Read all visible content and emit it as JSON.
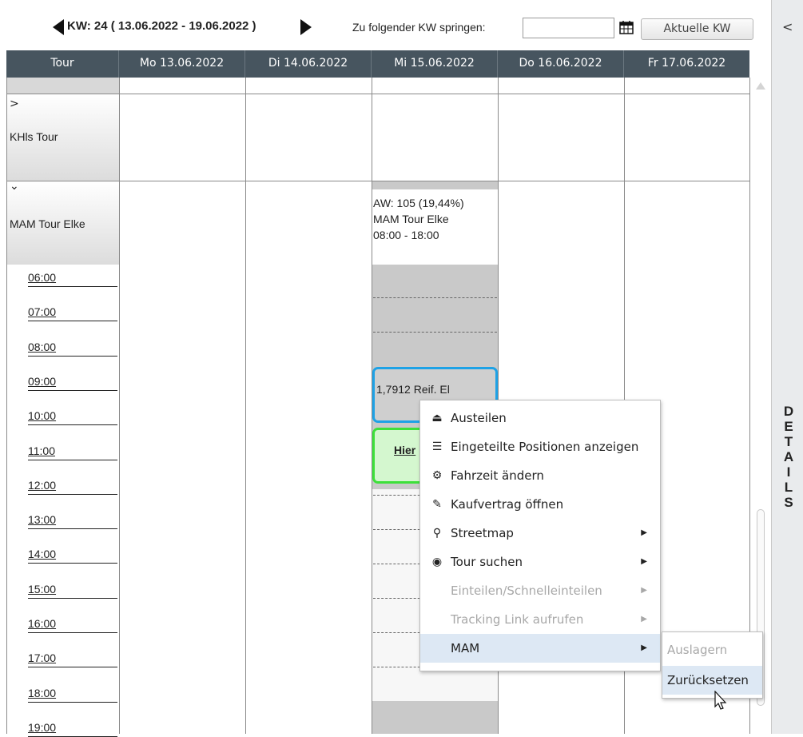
{
  "toolbar": {
    "week_label": "KW: 24",
    "week_range": "( 13.06.2022 - 19.06.2022 )",
    "jump_label": "Zu folgender KW springen:",
    "jump_value": "",
    "current_week_button": "Aktuelle KW"
  },
  "side_panel": {
    "collapse_label": "<",
    "details_letters": [
      "D",
      "E",
      "T",
      "A",
      "I",
      "L",
      "S"
    ]
  },
  "grid": {
    "header": [
      "Tour",
      "Mo 13.06.2022",
      "Di 14.06.2022",
      "Mi 15.06.2022",
      "Do 16.06.2022",
      "Fr 17.06.2022"
    ],
    "tours": [
      {
        "toggle": ">",
        "name": "KHls Tour"
      },
      {
        "toggle": "⌄",
        "name": "MAM Tour Elke"
      }
    ],
    "tour_summary": {
      "line1": "AW: 105 (19,44%)",
      "line2": "MAM Tour Elke",
      "line3": "08:00 - 18:00"
    },
    "times": [
      "06:00",
      "07:00",
      "08:00",
      "09:00",
      "10:00",
      "11:00",
      "12:00",
      "13:00",
      "14:00",
      "15:00",
      "16:00",
      "17:00",
      "18:00",
      "19:00"
    ],
    "events": {
      "blue_text": "1,7912 Reif. El",
      "green_link": "Hier"
    }
  },
  "context_menu": {
    "items": [
      {
        "label": "Austeilen",
        "icon": "eject-icon",
        "glyph": "⏏",
        "disabled": false,
        "submenu": false
      },
      {
        "label": "Eingeteilte Positionen anzeigen",
        "icon": "stack-icon",
        "glyph": "☰",
        "disabled": false,
        "submenu": false
      },
      {
        "label": "Fahrzeit ändern",
        "icon": "gears-icon",
        "glyph": "⚙",
        "disabled": false,
        "submenu": false
      },
      {
        "label": "Kaufvertrag öffnen",
        "icon": "contract-icon",
        "glyph": "✎",
        "disabled": false,
        "submenu": false
      },
      {
        "label": "Streetmap",
        "icon": "map-marker-icon",
        "glyph": "⚲",
        "disabled": false,
        "submenu": true
      },
      {
        "label": "Tour suchen",
        "icon": "globe-icon",
        "glyph": "◉",
        "disabled": false,
        "submenu": true
      },
      {
        "label": "Einteilen/Schnelleinteilen",
        "icon": "",
        "glyph": "",
        "disabled": true,
        "submenu": true
      },
      {
        "label": "Tracking Link aufrufen",
        "icon": "",
        "glyph": "",
        "disabled": true,
        "submenu": true
      },
      {
        "label": "MAM",
        "icon": "",
        "glyph": "",
        "disabled": false,
        "submenu": true,
        "highlighted": true
      }
    ]
  },
  "submenu": {
    "items": [
      {
        "label": "Auslagern",
        "disabled": true
      },
      {
        "label": "Zurücksetzen",
        "disabled": false,
        "highlighted": true
      }
    ]
  }
}
